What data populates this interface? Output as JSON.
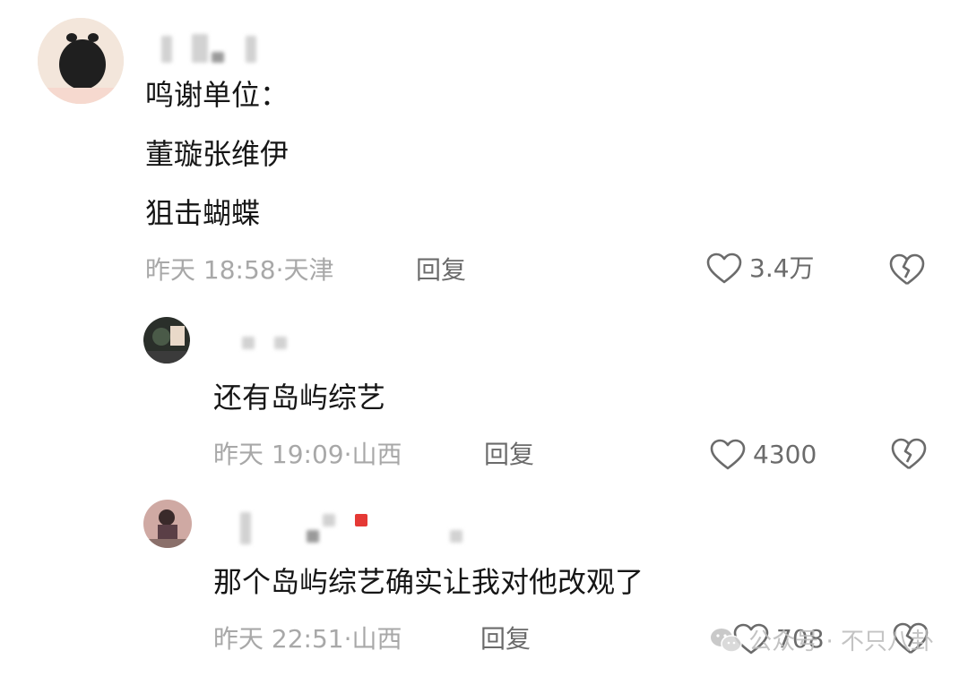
{
  "comments": [
    {
      "content": [
        "鸣谢单位：",
        "董璇张维伊",
        "狙击蝴蝶"
      ],
      "time": "昨天 18:58",
      "location": "天津",
      "reply_label": "回复",
      "likes": "3.4万"
    },
    {
      "content": [
        "还有岛屿综艺"
      ],
      "time": "昨天 19:09",
      "location": "山西",
      "reply_label": "回复",
      "likes": "4300"
    },
    {
      "content": [
        "那个岛屿综艺确实让我对他改观了"
      ],
      "time": "昨天 22:51",
      "location": "山西",
      "reply_label": "回复",
      "likes": "708"
    }
  ],
  "separator": "·",
  "watermark": {
    "text": "公众号 · 不只八卦",
    "icon": "wechat-icon"
  },
  "icons": {
    "like": "heart-outline-icon",
    "dislike": "broken-heart-icon"
  },
  "colors": {
    "text": "#161616",
    "meta": "#a8a8a8",
    "action": "#6b6b6b",
    "badge": "#e53935"
  }
}
